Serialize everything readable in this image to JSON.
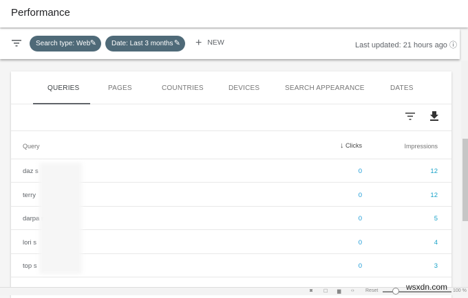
{
  "header": {
    "title": "Performance"
  },
  "toolbar": {
    "filter_icon": "filter-icon",
    "chips": [
      {
        "label": "Search type: Web"
      },
      {
        "label": "Date: Last 3 months"
      }
    ],
    "new_label": "NEW",
    "last_updated": "Last updated: 21 hours ago"
  },
  "tabs": [
    {
      "label": "QUERIES",
      "active": true
    },
    {
      "label": "PAGES"
    },
    {
      "label": "COUNTRIES"
    },
    {
      "label": "DEVICES"
    },
    {
      "label": "SEARCH APPEARANCE"
    },
    {
      "label": "DATES"
    }
  ],
  "table": {
    "columns": {
      "query": "Query",
      "clicks": "Clicks",
      "impressions": "Impressions"
    },
    "rows": [
      {
        "query": "daz s",
        "clicks": "0",
        "impressions": "12"
      },
      {
        "query": "terry",
        "clicks": "0",
        "impressions": "12"
      },
      {
        "query": "darpa                s",
        "clicks": "0",
        "impressions": "5"
      },
      {
        "query": "lori s",
        "clicks": "0",
        "impressions": "4"
      },
      {
        "query": "top s",
        "clicks": "0",
        "impressions": "3"
      }
    ]
  },
  "bottom": {
    "reset": "Reset",
    "zoom": "100 %"
  },
  "watermark": "wsxdn.com",
  "colors": {
    "chip": "#4f6a78",
    "link": "#1a9bd7"
  }
}
